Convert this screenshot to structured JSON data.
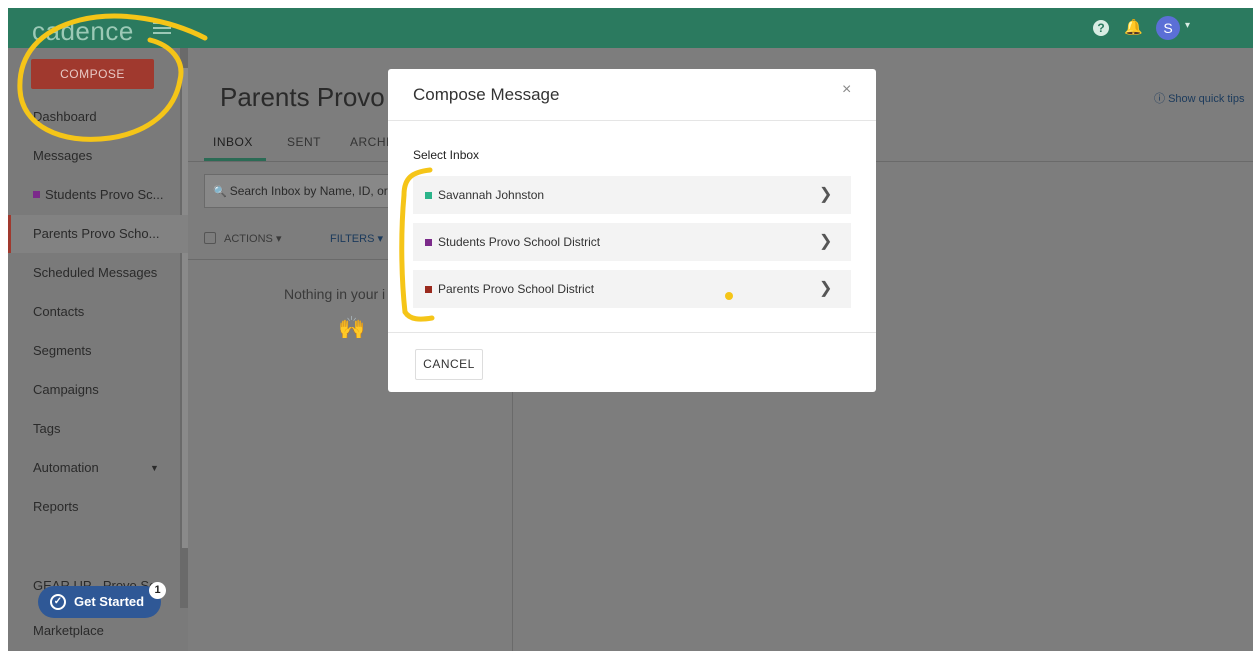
{
  "app": {
    "logo": "cadence"
  },
  "topbar": {
    "avatar_initial": "S"
  },
  "sidebar": {
    "compose_label": "COMPOSE",
    "items": [
      {
        "label": "Dashboard"
      },
      {
        "label": "Messages"
      },
      {
        "label": "Students Provo Sc...",
        "color": "#7b2a8a"
      },
      {
        "label": "Parents Provo Scho...",
        "active": true
      },
      {
        "label": "Scheduled Messages"
      },
      {
        "label": "Contacts"
      },
      {
        "label": "Segments"
      },
      {
        "label": "Campaigns"
      },
      {
        "label": "Tags"
      },
      {
        "label": "Automation"
      },
      {
        "label": "Reports"
      },
      {
        "label": "GEAR UP - Provo Sc..."
      },
      {
        "label": "Marketplace"
      }
    ],
    "get_started": {
      "label": "Get Started",
      "badge": "1"
    }
  },
  "main": {
    "title": "Parents Provo S",
    "tabs": [
      {
        "label": "INBOX"
      },
      {
        "label": "SENT"
      },
      {
        "label": "ARCHIV"
      }
    ],
    "search_placeholder": "Search Inbox by Name, ID, or",
    "actions_label": "ACTIONS",
    "filters_label": "FILTERS",
    "empty_text": "Nothing in your i",
    "quick_tips": "Show quick tips"
  },
  "modal": {
    "title": "Compose Message",
    "close": "×",
    "select_label": "Select Inbox",
    "inboxes": [
      {
        "label": "Savannah Johnston",
        "color": "#2bb48a"
      },
      {
        "label": "Students Provo School District",
        "color": "#7b2a8a"
      },
      {
        "label": "Parents Provo School District",
        "color": "#9a2a1e"
      }
    ],
    "cancel_label": "CANCEL"
  },
  "colors": {
    "brand": "#2b7a5f",
    "compose": "#a0392e",
    "annotation": "#f5c518"
  }
}
